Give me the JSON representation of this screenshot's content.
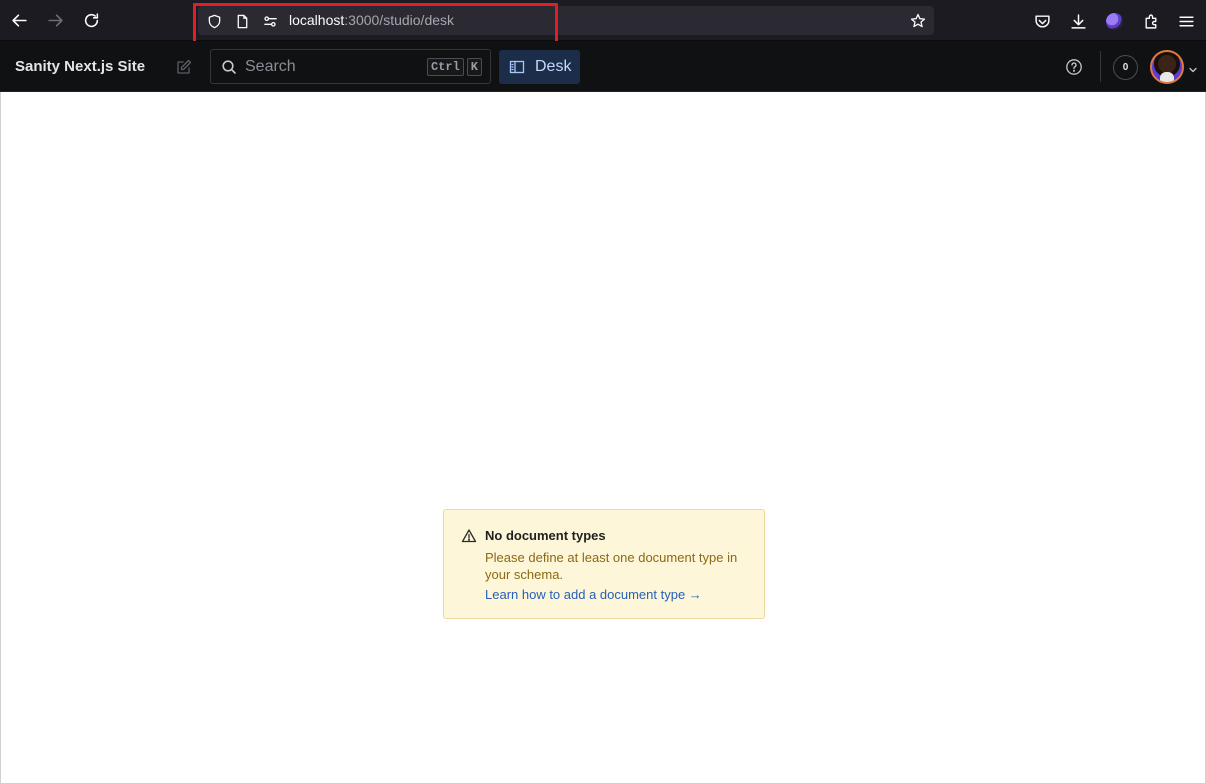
{
  "browser": {
    "url_host": "localhost",
    "url_path": ":3000/studio/desk",
    "icons": [
      "back-icon",
      "forward-icon",
      "reload-icon",
      "shield-icon",
      "page-icon",
      "permissions-icon",
      "bookmark-star-icon",
      "pocket-icon",
      "download-icon",
      "profile-icon",
      "extensions-icon",
      "menu-icon"
    ]
  },
  "studio": {
    "site_title": "Sanity Next.js Site",
    "search": {
      "placeholder": "Search",
      "shortcut_key1": "Ctrl",
      "shortcut_key2": "K"
    },
    "tool_label": "Desk",
    "presence_count": "0"
  },
  "warning": {
    "title": "No document types",
    "body": "Please define at least one document type in your schema.",
    "link_text": "Learn how to add a document type →"
  },
  "colors": {
    "browser_bg": "#1c1b22",
    "studio_header_bg": "#101112",
    "highlight_red": "#e11d26",
    "desk_active_bg": "#1c2d4a",
    "warning_bg": "#fdf6d8",
    "link_blue": "#2860b8"
  }
}
